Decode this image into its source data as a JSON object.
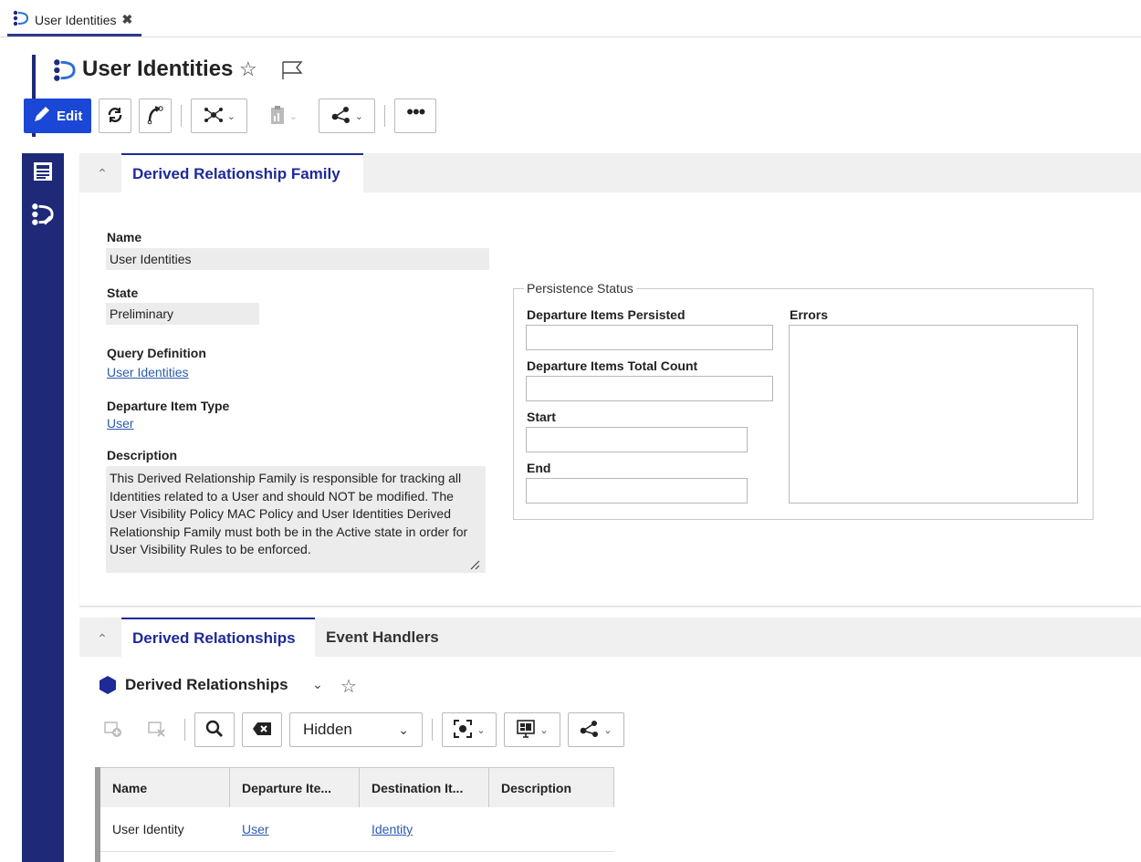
{
  "tab": {
    "label": "User Identities",
    "close": "✖"
  },
  "header": {
    "title": "User Identities",
    "star": "☆"
  },
  "toolbar": {
    "edit_label": "Edit"
  },
  "panel1": {
    "tab_label": "Derived Relationship Family",
    "fields": {
      "name_label": "Name",
      "name_value": "User Identities",
      "state_label": "State",
      "state_value": "Preliminary",
      "query_label": "Query Definition",
      "query_value": "User Identities",
      "dep_type_label": "Departure Item Type",
      "dep_type_value": "User",
      "desc_label": "Description",
      "desc_value": "This Derived Relationship Family is responsible for tracking all Identities related to a User and should NOT be modified. The User Visibility Policy MAC Policy and User Identities Derived Relationship Family must both be in the Active state in order for User Visibility Rules to be enforced."
    },
    "persistence": {
      "legend": "Persistence Status",
      "persisted_label": "Departure Items Persisted",
      "total_label": "Departure Items Total Count",
      "start_label": "Start",
      "end_label": "End",
      "errors_label": "Errors"
    }
  },
  "panel2": {
    "tabs": [
      "Derived Relationships",
      "Event Handlers"
    ],
    "section_title": "Derived Relationships",
    "star": "☆",
    "filter_value": "Hidden",
    "grid": {
      "columns": [
        "Name",
        "Departure Ite...",
        "Destination It...",
        "Description"
      ],
      "rows": [
        {
          "name": "User Identity",
          "departure": "User",
          "destination": "Identity",
          "description": ""
        }
      ]
    }
  },
  "colors": {
    "accent": "#1e2a78",
    "edit_button": "#1b47d6",
    "link": "#2b5bb0",
    "tab_active": "#1e2a98"
  }
}
